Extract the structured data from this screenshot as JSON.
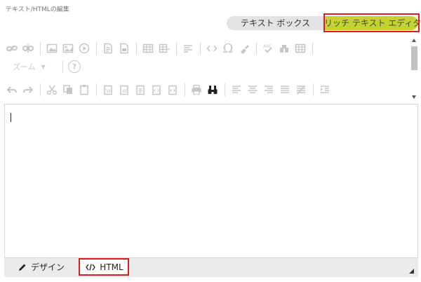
{
  "section_title": "テキスト/HTMLの編集",
  "mode_toggle": {
    "textbox_label": "テキスト ボックス",
    "rich_label": "リッチ テキスト エディタ",
    "active": "rich"
  },
  "toolbar": {
    "zoom_label": "ズーム",
    "help_label": "?"
  },
  "editor": {
    "content": ""
  },
  "bottom_tabs": {
    "design_label": "デザイン",
    "html_label": "HTML"
  },
  "colors": {
    "active_mode": "#c6d22e",
    "highlight_border": "#e01b1b",
    "disabled_icon": "#c6c6c6"
  }
}
